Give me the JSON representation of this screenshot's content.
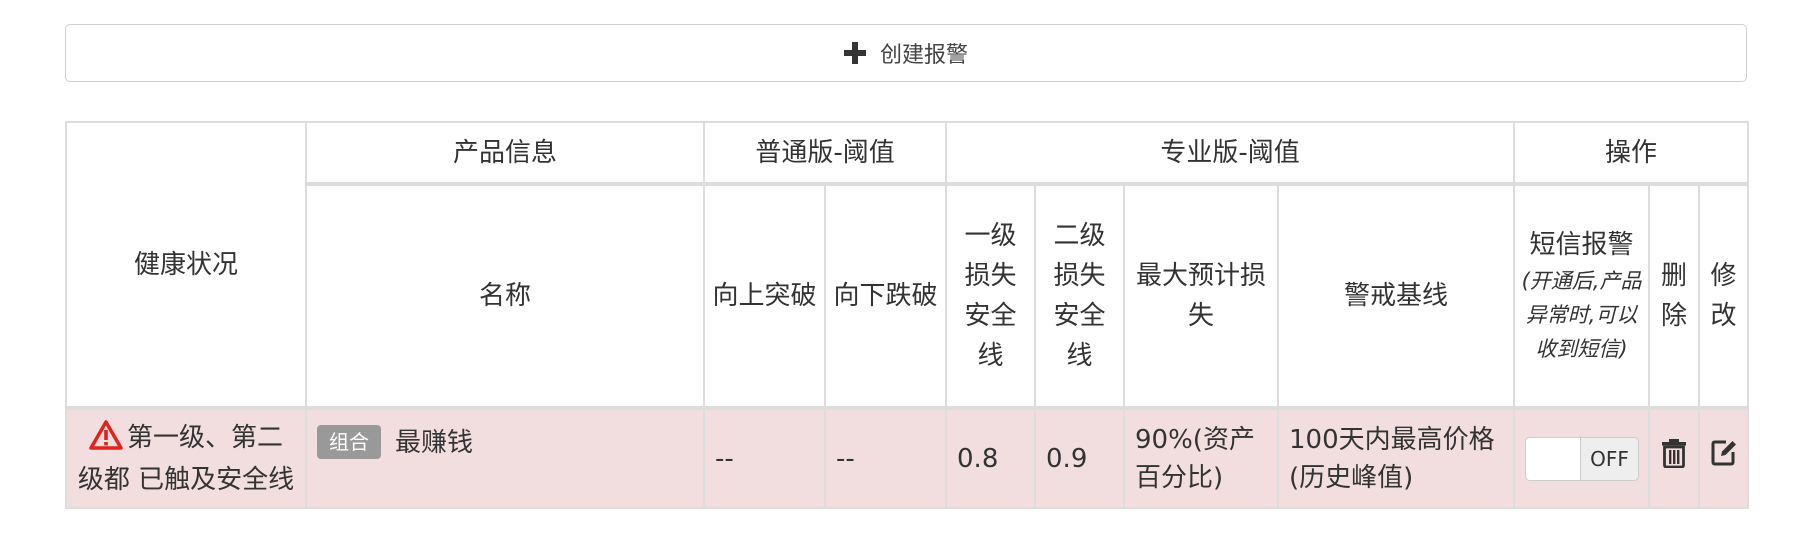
{
  "create_button": {
    "label": "创建报警",
    "icon": "plus-icon"
  },
  "table": {
    "headers": {
      "health": "健康状况",
      "product_info": "产品信息",
      "normal_threshold": "普通版-阈值",
      "pro_threshold": "专业版-阈值",
      "operations": "操作",
      "name": "名称",
      "up_break": "向上突破",
      "down_break": "向下跌破",
      "level1": "一级损失安全线",
      "level2": "二级损失安全线",
      "max_loss": "最大预计损失",
      "baseline": "警戒基线",
      "sms": "短信报警",
      "sms_note": "(开通后,产品异常时,可以收到短信)",
      "delete": "删除",
      "edit": "修改"
    },
    "rows": [
      {
        "health": "第一级、第二级都 已触及安全线",
        "health_icon": "warning-triangle-icon",
        "tag": "组合",
        "name": "最赚钱",
        "up_break": "--",
        "down_break": "--",
        "level1": "0.8",
        "level2": "0.9",
        "max_loss": "90%(资产百分比)",
        "baseline": "100天内最高价格(历史峰值)",
        "sms_toggle": "OFF",
        "delete_icon": "trash-icon",
        "edit_icon": "edit-icon"
      }
    ]
  },
  "colors": {
    "row_danger_bg": "#f2dede",
    "warning_red": "#e0241b",
    "tag_gray": "#999999"
  }
}
